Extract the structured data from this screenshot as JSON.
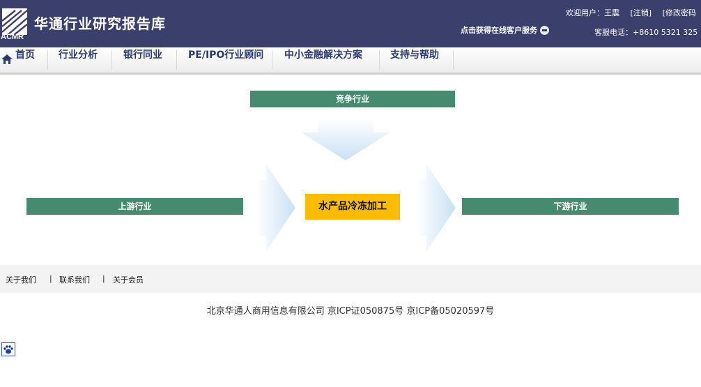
{
  "header": {
    "logo_text": "ACMR",
    "site_title": "华通行业研究报告库",
    "welcome_user": "欢迎用户：王震",
    "logout": "[注销]",
    "change_password": "[修改密码",
    "service_link": "点击获得在线客户服务",
    "hotline": "客服电话：+8610 5321 325"
  },
  "nav": {
    "items": [
      {
        "label": "首页"
      },
      {
        "label": "行业分析"
      },
      {
        "label": "银行同业"
      },
      {
        "label": "PE/IPO行业顾问"
      },
      {
        "label": "中小金融解决方案"
      },
      {
        "label": "支持与帮助"
      }
    ]
  },
  "diagram": {
    "top": "竞争行业",
    "left": "上游行业",
    "center": "水产品冷冻加工",
    "right": "下游行业",
    "colors": {
      "bar": "#468a70",
      "center": "#fbbc05",
      "arrow": "#cfe3f4"
    }
  },
  "footer": {
    "links": [
      "关于我们",
      "|",
      "联系我们",
      "|",
      "关于会员"
    ],
    "copyright": "北京华通人商用信息有限公司  京ICP证050875号  京ICP备05020597号"
  },
  "icons": {
    "home": "home-icon",
    "paw": "paw-icon",
    "service": "service-icon"
  }
}
